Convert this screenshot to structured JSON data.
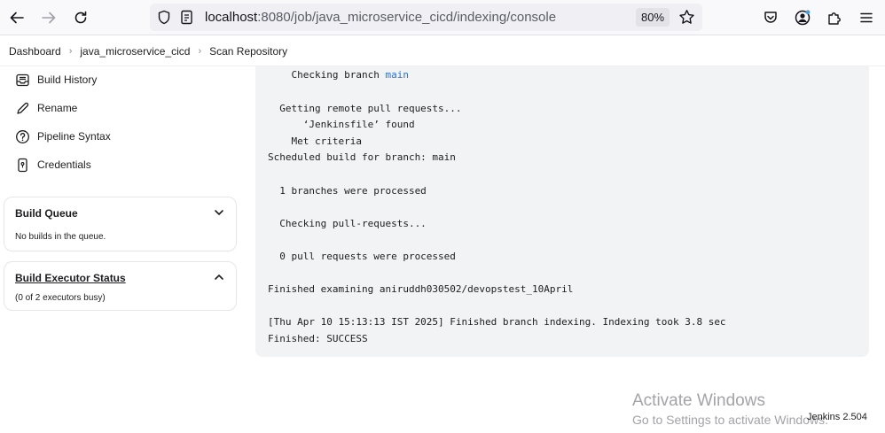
{
  "browser": {
    "url_host": "localhost",
    "url_path": ":8080/job/java_microservice_cicd/indexing/console",
    "zoom": "80%"
  },
  "breadcrumb": [
    "Dashboard",
    "java_microservice_cicd",
    "Scan Repository"
  ],
  "sidebar": {
    "items": [
      {
        "label": "Build History",
        "icon": "build-history-icon"
      },
      {
        "label": "Rename",
        "icon": "pencil-icon"
      },
      {
        "label": "Pipeline Syntax",
        "icon": "help-circle-icon"
      },
      {
        "label": "Credentials",
        "icon": "phone-key-icon"
      }
    ],
    "build_queue": {
      "title": "Build Queue",
      "body": "No builds in the queue."
    },
    "executor_status": {
      "title": "Build Executor Status",
      "body": "(0 of 2 executors busy)"
    }
  },
  "console": {
    "lines": [
      {
        "prefix": "    Checking branch ",
        "link": "main"
      },
      {
        "text": "  Getting remote pull requests..."
      },
      {
        "text": "      ‘Jenkinsfile’ found"
      },
      {
        "text": "    Met criteria"
      },
      {
        "text": "Scheduled build for branch: main"
      },
      {
        "text": "  1 branches were processed"
      },
      {
        "text": "  Checking pull-requests..."
      },
      {
        "text": "  0 pull requests were processed"
      },
      {
        "text": "Finished examining aniruddh030502/devopstest_10April"
      },
      {
        "text": "[Thu Apr 10 15:13:13 IST 2025] Finished branch indexing. Indexing took 3.8 sec"
      },
      {
        "text": "Finished: SUCCESS"
      }
    ]
  },
  "watermark": {
    "title": "Activate Windows",
    "subtitle": "Go to Settings to activate Windows."
  },
  "footer": {
    "version": "Jenkins 2.504"
  },
  "colors": {
    "link": "#2f6fd1",
    "console_bg": "#f2f3f5"
  }
}
